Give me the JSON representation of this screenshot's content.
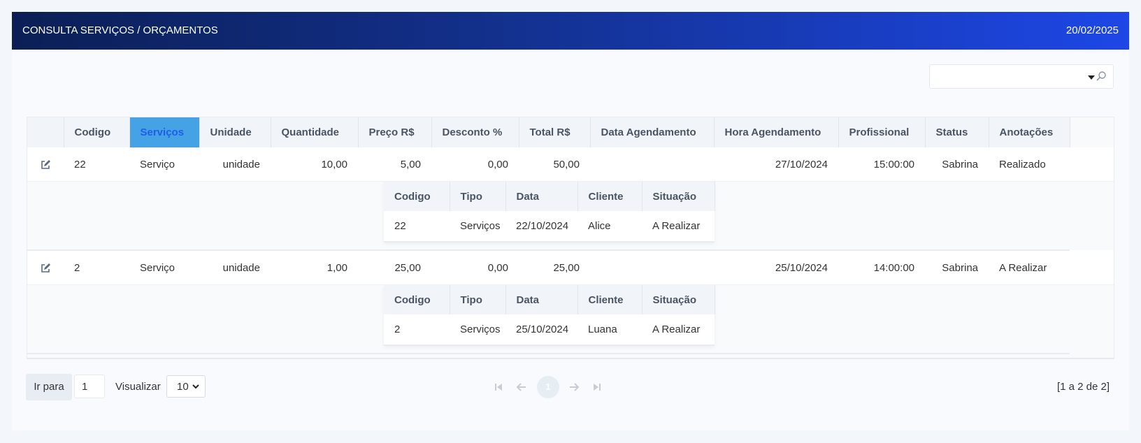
{
  "header": {
    "title": "CONSULTA SERVIÇOS / ORÇAMENTOS",
    "date": "20/02/2025"
  },
  "search": {
    "value": ""
  },
  "grid": {
    "columns": [
      "Codigo",
      "Serviços",
      "Unidade",
      "Quantidade",
      "Preço R$",
      "Desconto %",
      "Total R$",
      "Data Agendamento",
      "Hora Agendamento",
      "Profissional",
      "Status",
      "Anotações"
    ],
    "rows": [
      {
        "codigo": "22",
        "servico": "Serviço",
        "unidade": "unidade",
        "quantidade": "10,00",
        "preco": "5,00",
        "desconto": "0,00",
        "total": "50,00",
        "data": "27/10/2024",
        "hora": "15:00:00",
        "profissional": "Sabrina",
        "status": "Realizado",
        "anotacoes": "",
        "detail": {
          "codigo": "22",
          "tipo": "Serviços",
          "data": "22/10/2024",
          "cliente": "Alice",
          "situacao": "A Realizar"
        }
      },
      {
        "codigo": "2",
        "servico": "Serviço",
        "unidade": "unidade",
        "quantidade": "1,00",
        "preco": "25,00",
        "desconto": "0,00",
        "total": "25,00",
        "data": "25/10/2024",
        "hora": "14:00:00",
        "profissional": "Sabrina",
        "status": "A Realizar",
        "anotacoes": "",
        "detail": {
          "codigo": "2",
          "tipo": "Serviços",
          "data": "25/10/2024",
          "cliente": "Luana",
          "situacao": "A Realizar"
        }
      }
    ],
    "detail_columns": [
      "Codigo",
      "Tipo",
      "Data",
      "Cliente",
      "Situação"
    ]
  },
  "footer": {
    "goto_label": "Ir para",
    "page_input": "1",
    "view_label": "Visualizar",
    "rows_per_page": "10",
    "current_page": "1",
    "report": "[1 a 2 de 2]"
  }
}
